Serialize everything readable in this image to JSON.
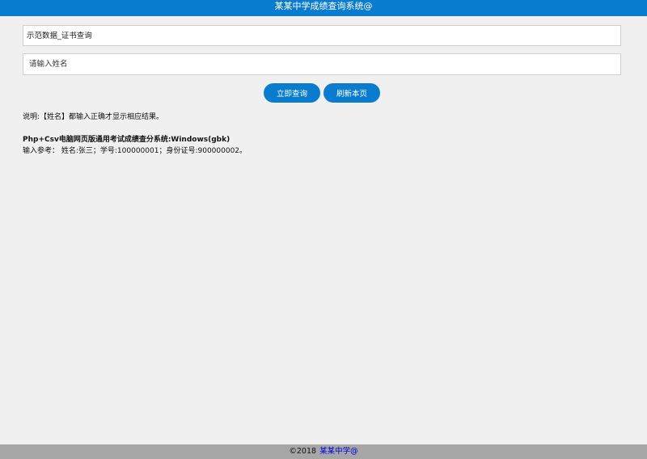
{
  "header": {
    "title": "某某中学成绩查询系统@"
  },
  "form": {
    "query_select": {
      "selected": "示范数据_证书查询",
      "options": [
        "示范数据_证书查询"
      ]
    },
    "name_input": {
      "value": "",
      "placeholder": "请输入姓名"
    },
    "query_button_label": "立即查询",
    "refresh_button_label": "刷新本页"
  },
  "content": {
    "note": "说明:【姓名】都输入正确才显示相应结果。",
    "system_title": "Php+Csv电脑网页版通用考试成绩查分系统:Windows(gbk)",
    "reference": "输入参考： 姓名:张三；学号:100000001；身份证号:900000002。"
  },
  "footer": {
    "copyright": "©2018",
    "link_text": "某某中学@"
  },
  "colors": {
    "primary": "#0a7ccf",
    "footer_bg": "#a6a6a6",
    "page_bg": "#f0f0f0",
    "link": "#0000dd"
  }
}
